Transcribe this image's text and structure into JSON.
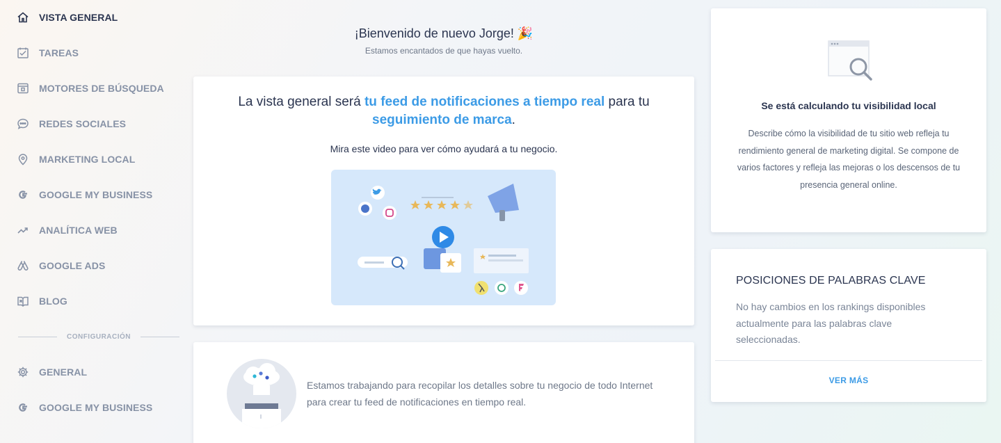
{
  "sidebar": {
    "items": [
      {
        "label": "VISTA GENERAL",
        "icon": "home-icon",
        "active": true
      },
      {
        "label": "TAREAS",
        "icon": "checkbox-icon"
      },
      {
        "label": "MOTORES DE BÚSQUEDA",
        "icon": "browser-icon"
      },
      {
        "label": "REDES SOCIALES",
        "icon": "chat-icon"
      },
      {
        "label": "MARKETING LOCAL",
        "icon": "map-pin-icon"
      },
      {
        "label": "GOOGLE MY BUSINESS",
        "icon": "google-icon"
      },
      {
        "label": "ANALÍTICA WEB",
        "icon": "trend-icon"
      },
      {
        "label": "GOOGLE ADS",
        "icon": "google-ads-icon"
      },
      {
        "label": "BLOG",
        "icon": "book-icon"
      }
    ],
    "section_label": "CONFIGURACIÓN",
    "settings_items": [
      {
        "label": "GENERAL",
        "icon": "gear-icon"
      },
      {
        "label": "GOOGLE MY BUSINESS",
        "icon": "google-icon"
      }
    ]
  },
  "welcome": {
    "title": "¡Bienvenido de nuevo Jorge! 🎉",
    "subtitle": "Estamos encantados de que hayas vuelto."
  },
  "feed_card": {
    "headline_1": "La vista general será ",
    "headline_hl_1": "tu feed de notificaciones a tiempo real",
    "headline_2": " para tu ",
    "headline_hl_2": "seguimiento de marca",
    "headline_3": ".",
    "subtitle": "Mira este video para ver cómo ayudará a tu negocio."
  },
  "work_card": {
    "text": "Estamos trabajando para recopilar los detalles sobre tu negocio de todo Internet para crear tu feed de notificaciones en tiempo real."
  },
  "visibility_card": {
    "title": "Se está calculando tu visibilidad local",
    "description": "Describe cómo la visibilidad de tu sitio web refleja tu rendimiento general de marketing digital. Se compone de varios factores y refleja las mejoras o los descensos de tu presencia general online."
  },
  "keywords_card": {
    "title": "POSICIONES DE PALABRAS CLAVE",
    "description": "No hay cambios en los rankings disponibles actualmente para las palabras clave seleccionadas.",
    "link": "VER MÁS"
  },
  "colors": {
    "accent": "#3c9be6",
    "text_dark": "#2b3550",
    "text_muted": "#8792a6"
  }
}
